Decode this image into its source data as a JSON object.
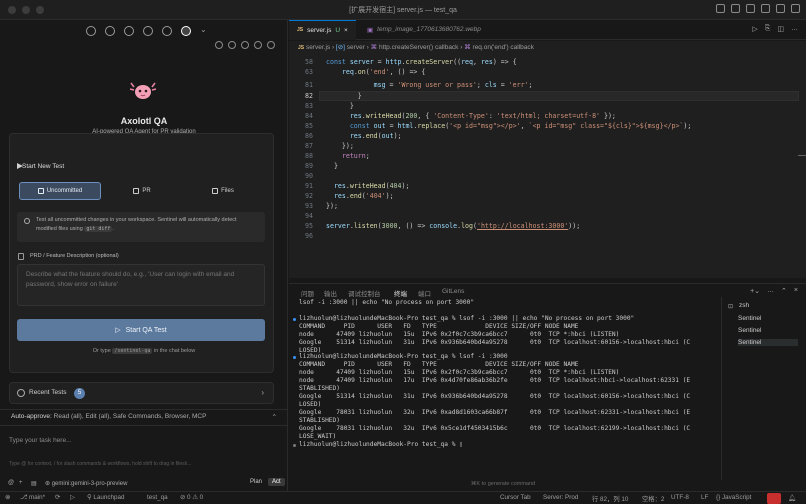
{
  "window": {
    "title": "[扩展开发宿主] server.js — test_qa"
  },
  "app": {
    "title": "Axolotl QA",
    "subtitle": "AI-powered QA Agent for PR validation"
  },
  "start": {
    "heading": "Start New Test",
    "tabs": [
      "Uncommitted",
      "PR",
      "Files"
    ],
    "info_a": "Test all uncommitted changes in your workspace. Sentinel will automatically detect modified files using",
    "info_code": "git diff",
    "info_b": ".",
    "prd_label": "PRD / Feature Description (optional)",
    "prd_placeholder": "Describe what the feature should do, e.g., 'User can login with email and password, show error on failure'",
    "button": "Start QA Test",
    "hint_a": "Or type",
    "hint_code": "/sentinel-qa",
    "hint_b": "in the chat below"
  },
  "recent": {
    "label": "Recent Tests",
    "count": "5"
  },
  "auto_approve": {
    "label": "Auto-approve:",
    "value": "Read (all), Edit (all), Safe Commands, Browser, MCP"
  },
  "chat": {
    "placeholder": "Type your task here...",
    "hint": "Type @ for context, / for slash commands & workflows, hold shift to drag in files/i...",
    "model": "gemini:gemini-3-pro-preview",
    "plan": "Plan",
    "act": "Act"
  },
  "editor": {
    "tabs": [
      {
        "label": "server.js",
        "badge": "U"
      },
      {
        "label": "temp_image_1770613680762.webp"
      }
    ],
    "breadcrumb": [
      "server.js",
      "server",
      "http.createServer() callback",
      "req.on('end') callback"
    ],
    "lines": [
      {
        "n": "58"
      },
      {
        "n": "63"
      },
      {
        "n": "81"
      },
      {
        "n": "82"
      },
      {
        "n": "83"
      },
      {
        "n": "84"
      },
      {
        "n": "85"
      },
      {
        "n": "86"
      },
      {
        "n": "87"
      },
      {
        "n": "88"
      },
      {
        "n": "89"
      },
      {
        "n": "90"
      },
      {
        "n": "91"
      },
      {
        "n": "92"
      },
      {
        "n": "93"
      },
      {
        "n": "94"
      },
      {
        "n": "95"
      },
      {
        "n": "96"
      }
    ]
  },
  "terminal": {
    "tabs": [
      "问题",
      "输出",
      "调试控制台",
      "终端",
      "端口",
      "GitLens"
    ],
    "lines": [
      "lsof -i :3000 || echo \"No process on port 3000\"",
      "lizhuolun@lizhuolundeMacBook-Pro test_qa % lsof -i :3000 || echo \"No process on port 3000\"",
      "COMMAND     PID      USER   FD   TYPE             DEVICE SIZE/OFF NODE NAME",
      "node      47409 lizhuolun   15u  IPv6 0x2f0c7c3b9ca6bcc7      0t0  TCP *:hbci (LISTEN)",
      "Google    51314 lizhuolun   31u  IPv6 0x936b640bd4a95278      0t0  TCP localhost:60156->localhost:hbci (C",
      "LOSED)",
      "lizhuolun@lizhuolundeMacBook-Pro test_qa % lsof -i :3000",
      "COMMAND     PID      USER   FD   TYPE             DEVICE SIZE/OFF NODE NAME",
      "node      47409 lizhuolun   15u  IPv6 0x2f0c7c3b9ca6bcc7      0t0  TCP *:hbci (LISTEN)",
      "node      47409 lizhuolun   17u  IPv6 0x4d70fe86ab36b2fe      0t0  TCP localhost:hbci->localhost:62331 (E",
      "STABLISHED)",
      "Google    51314 lizhuolun   31u  IPv6 0x936b640bd4a95278      0t0  TCP localhost:60156->localhost:hbci (C",
      "LOSED)",
      "Google    78031 lizhuolun   32u  IPv6 0xad8d1603ca66b87f      0t0  TCP localhost:62331->localhost:hbci (E",
      "STABLISHED)",
      "Google    78031 lizhuolun   32u  IPv6 0x5ce1df4503415b6c      0t0  TCP localhost:62199->localhost:hbci (C",
      "LOSE_WAIT)",
      "lizhuolun@lizhuolundeMacBook-Pro test_qa % ▯"
    ],
    "sessions": [
      "zsh",
      "Sentinel",
      "Sentinel",
      "Sentinel"
    ],
    "gen_hint": "⌘K to generate command"
  },
  "status": {
    "branch": "main*",
    "launchpad": "Launchpad",
    "folder": "test_qa",
    "problems": "⊘ 0 ⚠ 0",
    "cursor_tab": "Cursor Tab",
    "server": "Server: Prod",
    "position": "行 82，列 10",
    "spaces": "空格：2",
    "encoding": "UTF-8",
    "eol": "LF",
    "lang": "JavaScript"
  }
}
